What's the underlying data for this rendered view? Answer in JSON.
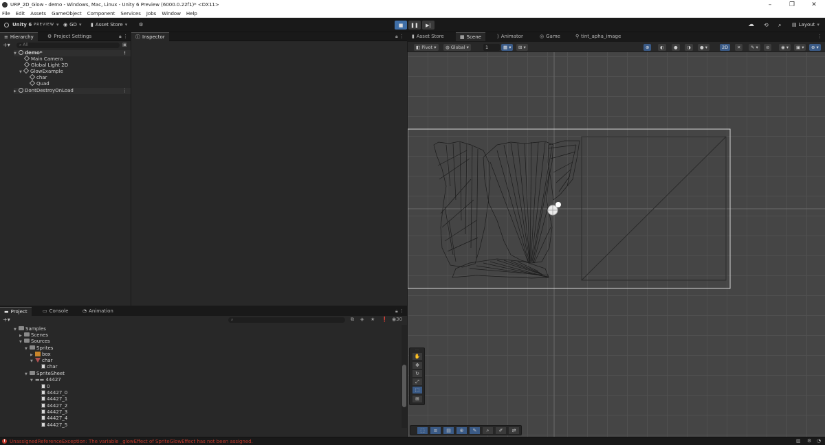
{
  "window": {
    "title": "URP_2D_Glow - demo - Windows, Mac, Linux - Unity 6 Preview (6000.0.22f1)* <DX11>"
  },
  "menu": [
    "File",
    "Edit",
    "Assets",
    "GameObject",
    "Component",
    "Services",
    "Jobs",
    "Window",
    "Help"
  ],
  "toolbar": {
    "brand": "Unity 6",
    "brand_sub": "PREVIEW",
    "account": "GD",
    "asset_store": "Asset Store",
    "layout": "Layout"
  },
  "hierarchy": {
    "tabs": [
      "Hierarchy",
      "Project Settings"
    ],
    "search_placeholder": "All",
    "rows": [
      {
        "label": "demo*"
      },
      {
        "label": "Main Camera"
      },
      {
        "label": "Global Light 2D"
      },
      {
        "label": "GlowExample"
      },
      {
        "label": "char"
      },
      {
        "label": "Quad"
      },
      {
        "label": "DontDestroyOnLoad"
      }
    ]
  },
  "inspector": {
    "tab": "Inspector"
  },
  "scene": {
    "tabs": [
      "Asset Store",
      "Scene",
      "Animator",
      "Game",
      "tint_apha_image"
    ],
    "pivot": "Pivot",
    "global": "Global",
    "grid_value": "1",
    "mode_2d": "2D"
  },
  "project": {
    "tabs": [
      "Project",
      "Console",
      "Animation"
    ],
    "visible_count": "30",
    "tree": [
      {
        "label": "Samples"
      },
      {
        "label": "Scenes"
      },
      {
        "label": "Sources"
      },
      {
        "label": "Sprites"
      },
      {
        "label": "box"
      },
      {
        "label": "char"
      },
      {
        "label": "char"
      },
      {
        "label": "SpriteSheet"
      },
      {
        "label": "44427"
      },
      {
        "label": "0"
      },
      {
        "label": "44427_0"
      },
      {
        "label": "44427_1"
      },
      {
        "label": "44427_2"
      },
      {
        "label": "44427_3"
      },
      {
        "label": "44427_4"
      },
      {
        "label": "44427_5"
      }
    ]
  },
  "status": {
    "message": "UnassignedReferenceException: The variable _glowEffect of SpriteGlowEffect has not been assigned."
  },
  "colors": {
    "accent": "#3f6ea6",
    "error": "#c0392b",
    "panel": "#282828",
    "scene_bg": "#454545"
  }
}
